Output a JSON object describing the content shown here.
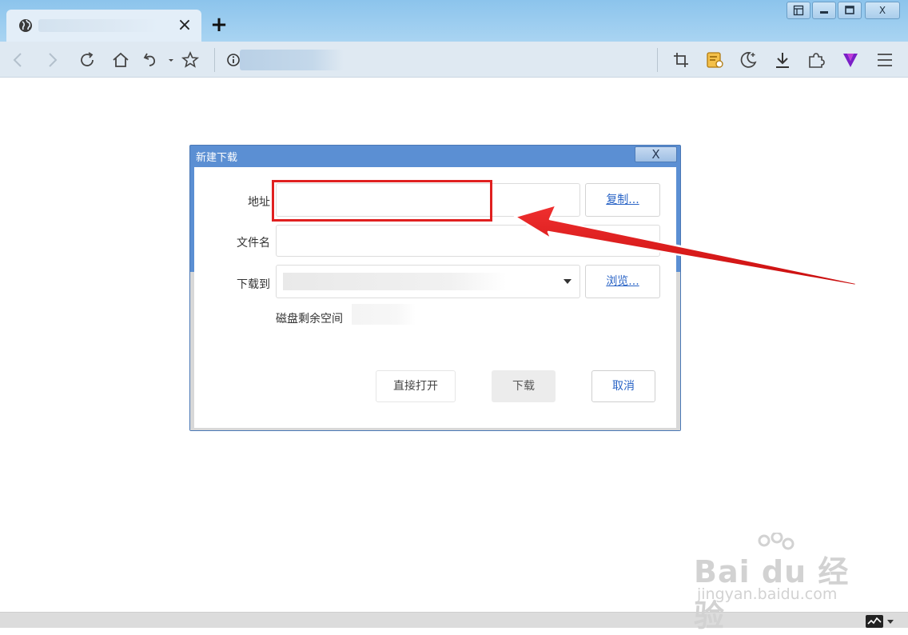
{
  "browser": {
    "tab_close": "×",
    "new_tab": "+",
    "window_close": "X"
  },
  "dialog": {
    "title": "新建下载",
    "close_label": "X",
    "url_label": "地址",
    "url_value": "",
    "copy_button": "复制...",
    "filename_label": "文件名",
    "filename_value": "",
    "saveto_label": "下载到",
    "browse_button": "浏览...",
    "disk_space_label": "磁盘剩余空间",
    "open_button": "直接打开",
    "download_button": "下载",
    "cancel_button": "取消"
  },
  "watermark": {
    "logo": "Bai du 经验",
    "url": "jingyan.baidu.com"
  },
  "colors": {
    "dialog_frame": "#5b8fd3",
    "highlight": "#e02020",
    "link": "#2a64c6"
  }
}
